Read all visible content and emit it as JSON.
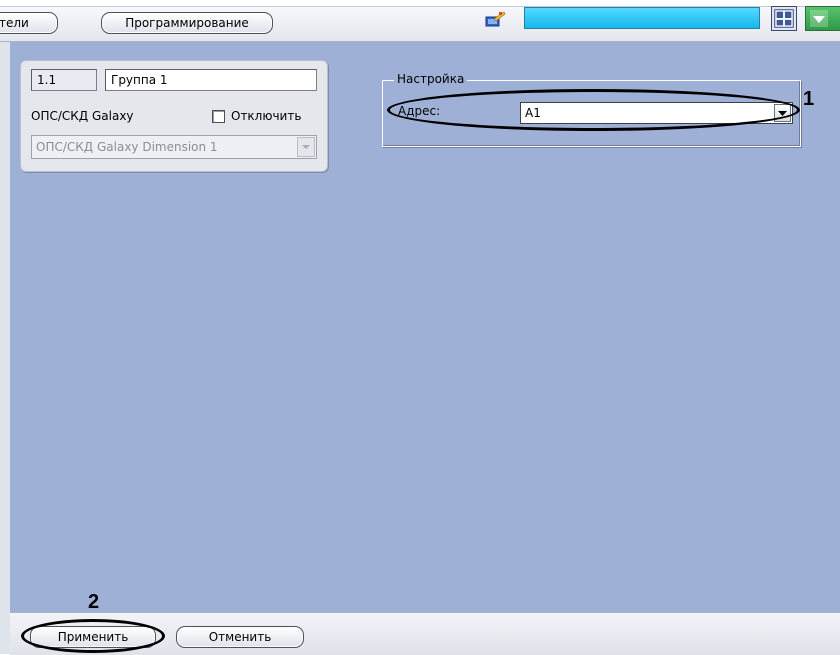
{
  "toolbar": {
    "left_tab_label": "тели",
    "programming_label": "Программирование"
  },
  "object_card": {
    "id_value": "1.1",
    "name_value": "Группа 1",
    "device_label": "ОПС/СКД Galaxy",
    "disable_label": "Отключить",
    "disable_checked": false,
    "device_select_value": "ОПС/СКД Galaxy Dimension 1"
  },
  "settings": {
    "group_title": "Настройка",
    "address_label": "Адрес:",
    "address_value": "A1"
  },
  "footer": {
    "apply_label": "Применить",
    "cancel_label": "Отменить"
  },
  "callouts": {
    "one": "1",
    "two": "2"
  },
  "colors": {
    "panel_background": "#9eb0d6",
    "toolbar_cyan": "#14b8ec",
    "toolbar_green": "#2e9a48"
  }
}
